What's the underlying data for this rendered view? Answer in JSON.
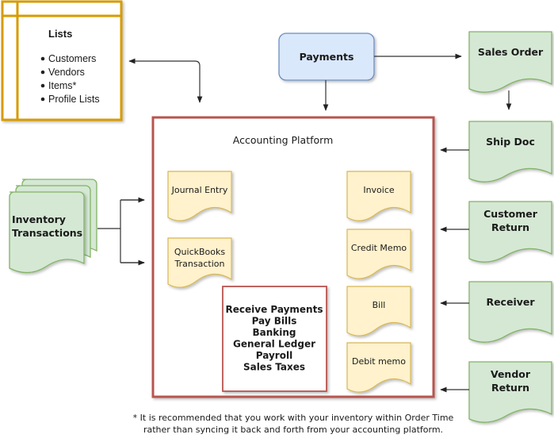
{
  "lists": {
    "title": "Lists",
    "items": [
      "Customers",
      "Vendors",
      "Items*",
      "Profile Lists"
    ]
  },
  "payments": {
    "label": "Payments"
  },
  "platform": {
    "title": "Accounting Platform",
    "left_docs": [
      {
        "lines": [
          "Journal Entry"
        ]
      },
      {
        "lines": [
          "QuickBooks",
          "Transaction"
        ]
      }
    ],
    "right_docs": [
      {
        "lines": [
          "Invoice"
        ]
      },
      {
        "lines": [
          "Credit Memo"
        ]
      },
      {
        "lines": [
          "Bill"
        ]
      },
      {
        "lines": [
          "Debit memo"
        ]
      }
    ],
    "functions": [
      "Receive Payments",
      "Pay Bills",
      "Banking",
      "General Ledger",
      "Payroll",
      "Sales Taxes"
    ]
  },
  "inventory": {
    "lines": [
      "Inventory",
      "Transactions"
    ]
  },
  "order_docs": [
    {
      "lines": [
        "Sales Order"
      ]
    },
    {
      "lines": [
        "Ship Doc"
      ]
    },
    {
      "lines": [
        "Customer",
        "Return"
      ]
    },
    {
      "lines": [
        "Receiver"
      ]
    },
    {
      "lines": [
        "Vendor",
        "Return"
      ]
    }
  ],
  "footnote": [
    "* It is recommended that you work with your inventory within Order Time",
    "rather than syncing it back and forth from your accounting platform."
  ],
  "colors": {
    "lists_border": "#d79b00",
    "platform_border": "#b85450",
    "payments_fill": "#dae8fc",
    "payments_border": "#6c8ebf",
    "green_fill": "#d5e8d4",
    "green_border": "#82b366",
    "yellow_fill": "#fff2cc",
    "yellow_border": "#d6b656"
  }
}
